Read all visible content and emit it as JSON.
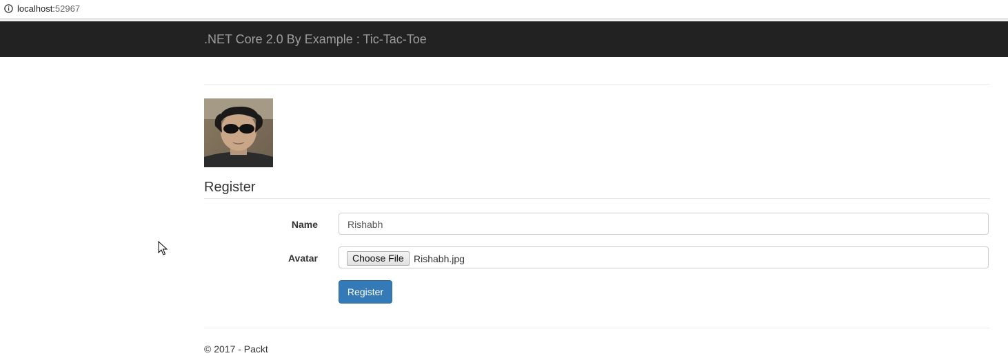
{
  "browser": {
    "url_host": "localhost:",
    "url_port": "52967"
  },
  "navbar": {
    "brand": ".NET Core 2.0 By Example : Tic-Tac-Toe"
  },
  "avatar": {
    "alt": "user avatar photo"
  },
  "form": {
    "heading": "Register",
    "name_label": "Name",
    "name_value": "Rishabh",
    "avatar_label": "Avatar",
    "choose_file_label": "Choose File",
    "file_name": "Rishabh.jpg",
    "submit_label": "Register"
  },
  "footer": {
    "text": "© 2017 - Packt"
  },
  "colors": {
    "navbar_bg": "#222222",
    "brand_text": "#9d9d9d",
    "primary": "#337ab7"
  }
}
